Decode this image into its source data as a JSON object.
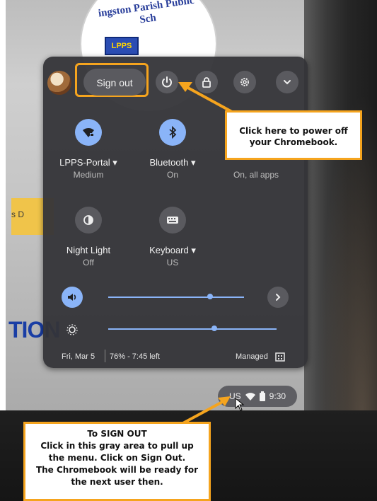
{
  "website": {
    "logo_text": "ingston Parish Public Sch",
    "logo_badge": "LPPS",
    "side_text": "s   D",
    "headline": "TION"
  },
  "quick_settings": {
    "sign_out_label": "Sign out",
    "features": [
      {
        "label": "LPPS-Portal ▾",
        "sub": "Medium",
        "icon": "wifi-locked-icon",
        "active": true
      },
      {
        "label": "Bluetooth ▾",
        "sub": "On",
        "icon": "bluetooth-icon",
        "active": true
      },
      {
        "label": "",
        "sub": "On, all apps",
        "icon": "notifications-icon",
        "active": false
      },
      {
        "label": "Night Light",
        "sub": "Off",
        "icon": "night-light-icon",
        "active": false
      },
      {
        "label": "Keyboard ▾",
        "sub": "US",
        "icon": "keyboard-icon",
        "active": false
      }
    ],
    "volume_level": 0.75,
    "brightness_level": 0.63,
    "date": "Fri, Mar 5",
    "battery_text": "76% - 7:45 left",
    "managed_label": "Managed"
  },
  "shelf": {
    "keyboard_layout": "US",
    "time": "9:30"
  },
  "callouts": {
    "power_text_1": "Click here to power off",
    "power_text_2": "your Chromebook.",
    "signout_lines": [
      "To SIGN OUT",
      "Click in this gray area to pull up",
      "the menu.  Click on Sign Out.",
      "The Chromebook will be ready for",
      "the next user then."
    ]
  },
  "colors": {
    "accent": "#8ab4f8",
    "panel": "#343438",
    "highlight": "#f5a41e"
  }
}
